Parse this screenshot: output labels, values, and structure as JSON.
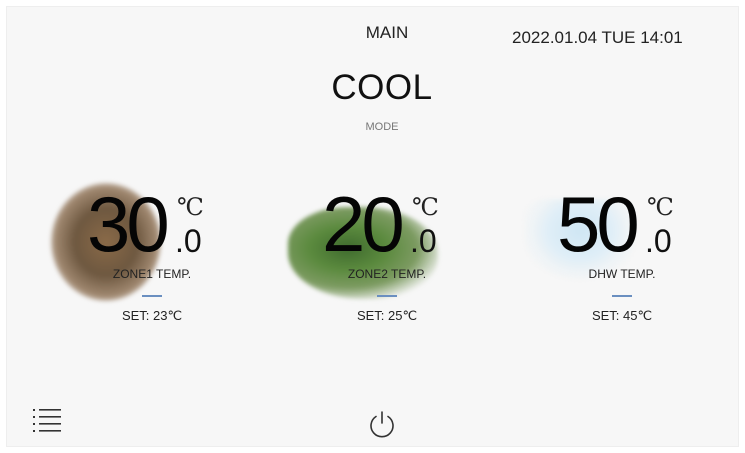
{
  "header": {
    "title": "MAIN",
    "datetime": "2022.01.04 TUE 14:01"
  },
  "mode": {
    "value": "COOL",
    "label": "MODE"
  },
  "zones": [
    {
      "integer": "30",
      "unit": "℃",
      "decimal": ".0",
      "label": "ZONE1 TEMP.",
      "set": "SET: 23℃"
    },
    {
      "integer": "20",
      "unit": "℃",
      "decimal": ".0",
      "label": "ZONE2 TEMP.",
      "set": "SET: 25℃"
    },
    {
      "integer": "50",
      "unit": "℃",
      "decimal": ".0",
      "label": "DHW TEMP.",
      "set": "SET: 45℃"
    }
  ],
  "footer": {
    "menu_icon": "list-menu-icon",
    "power_icon": "power-icon"
  },
  "colors": {
    "accent_bar": "#6a8fc0",
    "background": "#f7f7f7"
  }
}
